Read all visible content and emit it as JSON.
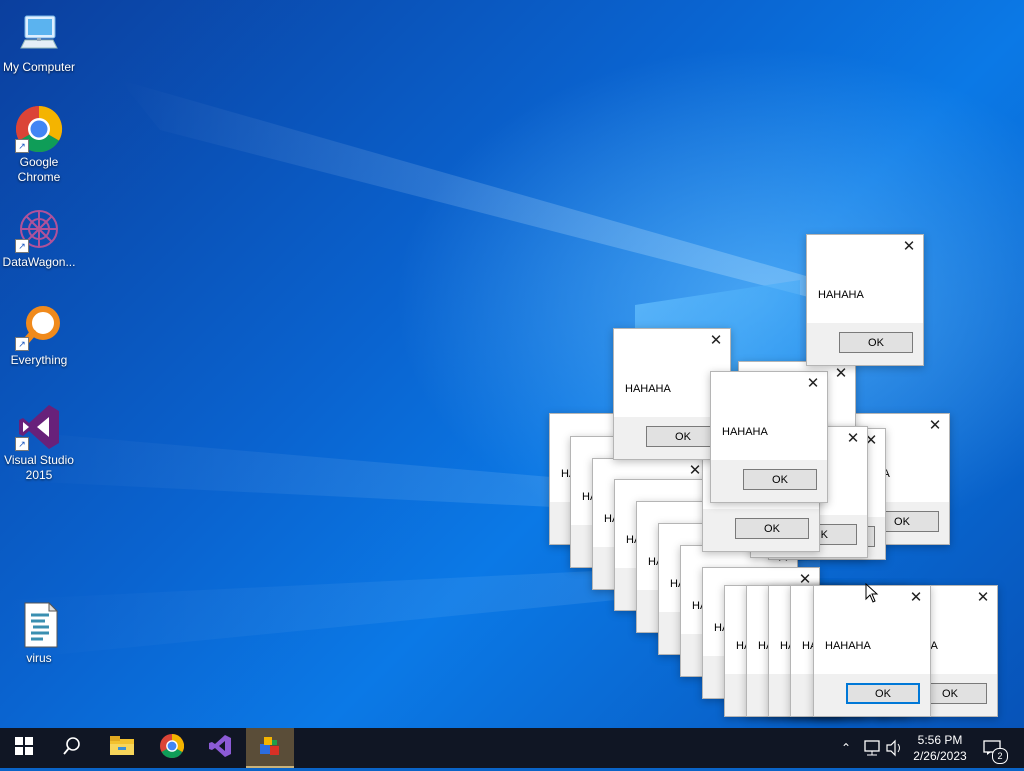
{
  "desktop_icons": [
    {
      "label": "My Computer"
    },
    {
      "label": "Google\nChrome"
    },
    {
      "label": "DataWagon..."
    },
    {
      "label": "Everything"
    },
    {
      "label": "Visual Studio\n2015"
    },
    {
      "label": "virus"
    }
  ],
  "dialog": {
    "message": "HAHAHA",
    "partial_message": "HA",
    "ok_label": "OK",
    "close_glyph": "✕"
  },
  "taskbar": {
    "apps": [
      "start-icon",
      "search-icon",
      "file-explorer-icon",
      "chrome-icon",
      "visual-studio-icon",
      "virus-app-icon"
    ],
    "clock_time": "5:56 PM",
    "clock_date": "2/26/2023",
    "notification_count": "2"
  },
  "colors": {
    "taskbar": "#101624",
    "accent": "#0078d7"
  }
}
